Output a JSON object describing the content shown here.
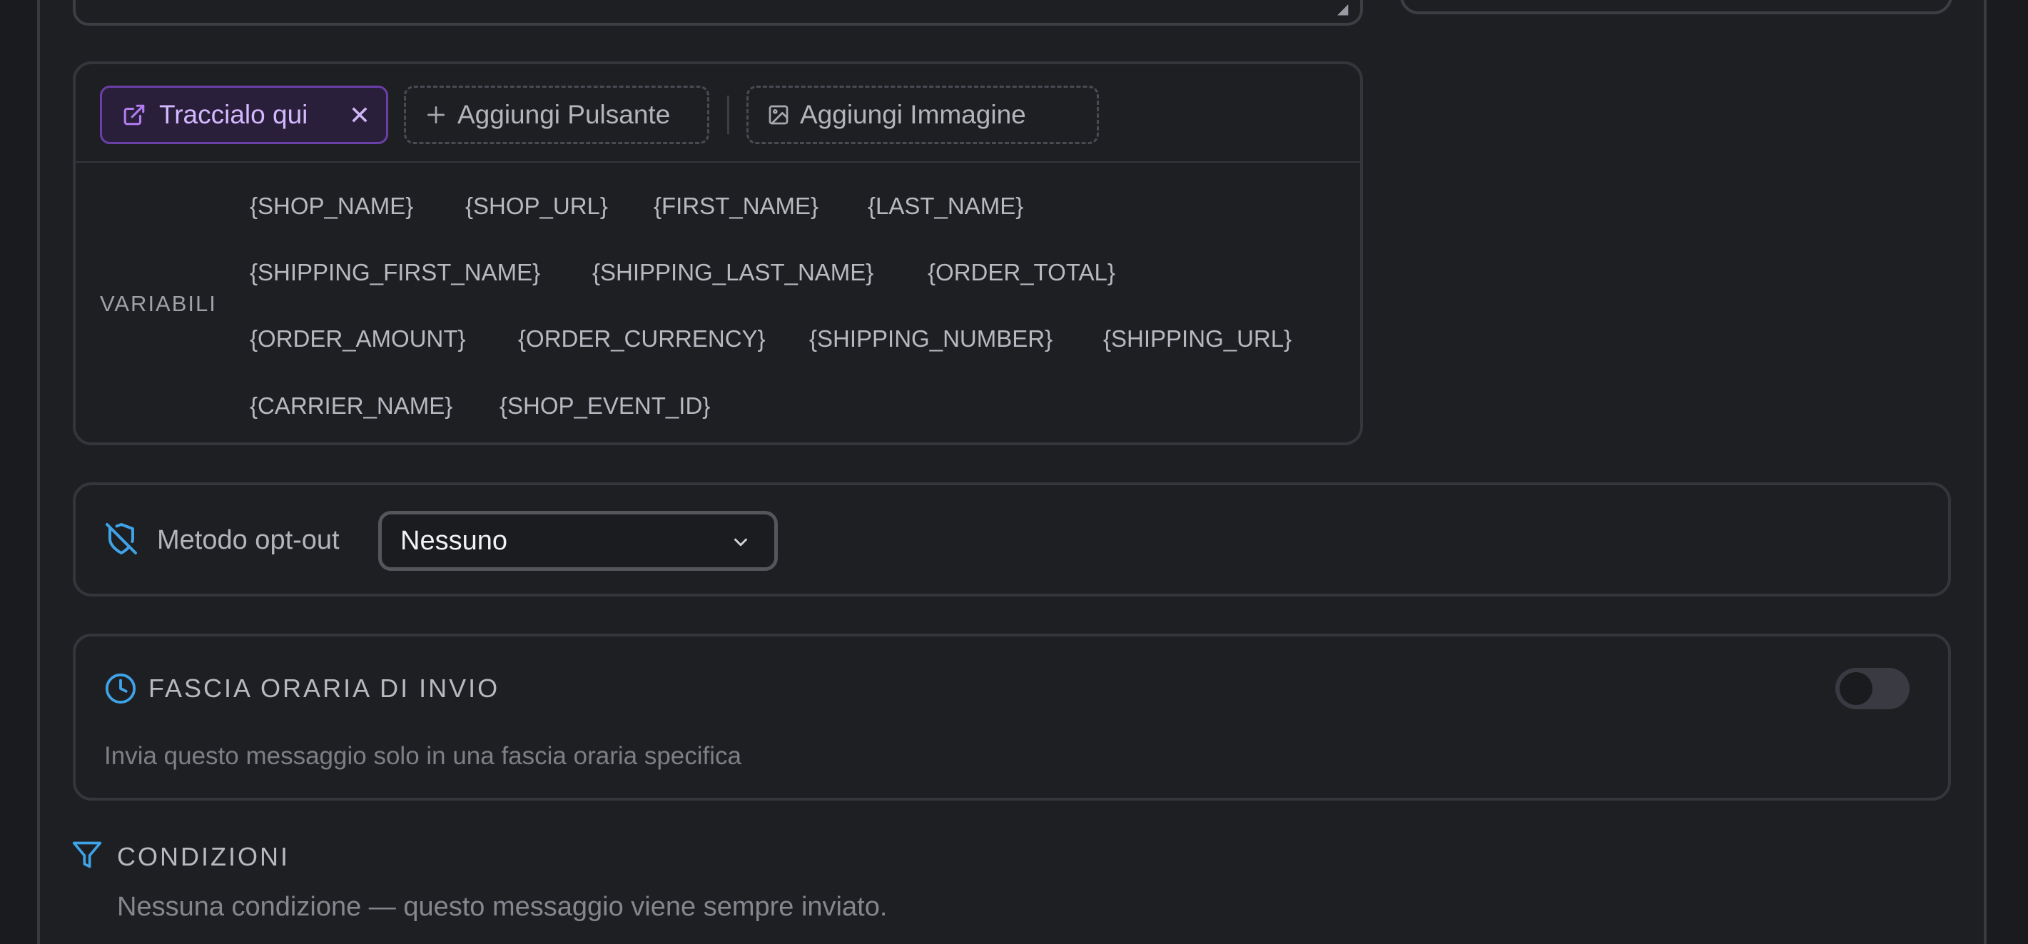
{
  "editor": {
    "toolbar": {
      "tracking_chip": {
        "label": "Traccialo qui",
        "icon": "external-link-icon",
        "remove_icon": "close-icon"
      },
      "add_button": {
        "label": "Aggiungi Pulsante",
        "icon": "plus-icon"
      },
      "add_image": {
        "label": "Aggiungi Immagine",
        "icon": "image-icon"
      }
    },
    "variables": {
      "label": "VARIABILI",
      "rows": [
        [
          "{SHOP_NAME}",
          "{SHOP_URL}",
          "{FIRST_NAME}",
          "{LAST_NAME}"
        ],
        [
          "{SHIPPING_FIRST_NAME}",
          "{SHIPPING_LAST_NAME}",
          "{ORDER_TOTAL}"
        ],
        [
          "{ORDER_AMOUNT}",
          "{ORDER_CURRENCY}",
          "{SHIPPING_NUMBER}",
          "{SHIPPING_URL}"
        ],
        [
          "{CARRIER_NAME}",
          "{SHOP_EVENT_ID}"
        ]
      ]
    }
  },
  "optout": {
    "label": "Metodo opt-out",
    "icon": "shield-off-icon",
    "select_value": "Nessuno"
  },
  "time_window": {
    "title": "FASCIA ORARIA DI INVIO",
    "icon": "clock-icon",
    "description": "Invia questo messaggio solo in una fascia oraria specifica",
    "enabled": false
  },
  "conditions": {
    "title": "CONDIZIONI",
    "icon": "filter-icon",
    "description": "Nessuna condizione — questo messaggio viene sempre inviato."
  },
  "colors": {
    "accent_purple": "#b07cf0",
    "accent_blue": "#3fa3e8",
    "background": "#1e1f23"
  }
}
